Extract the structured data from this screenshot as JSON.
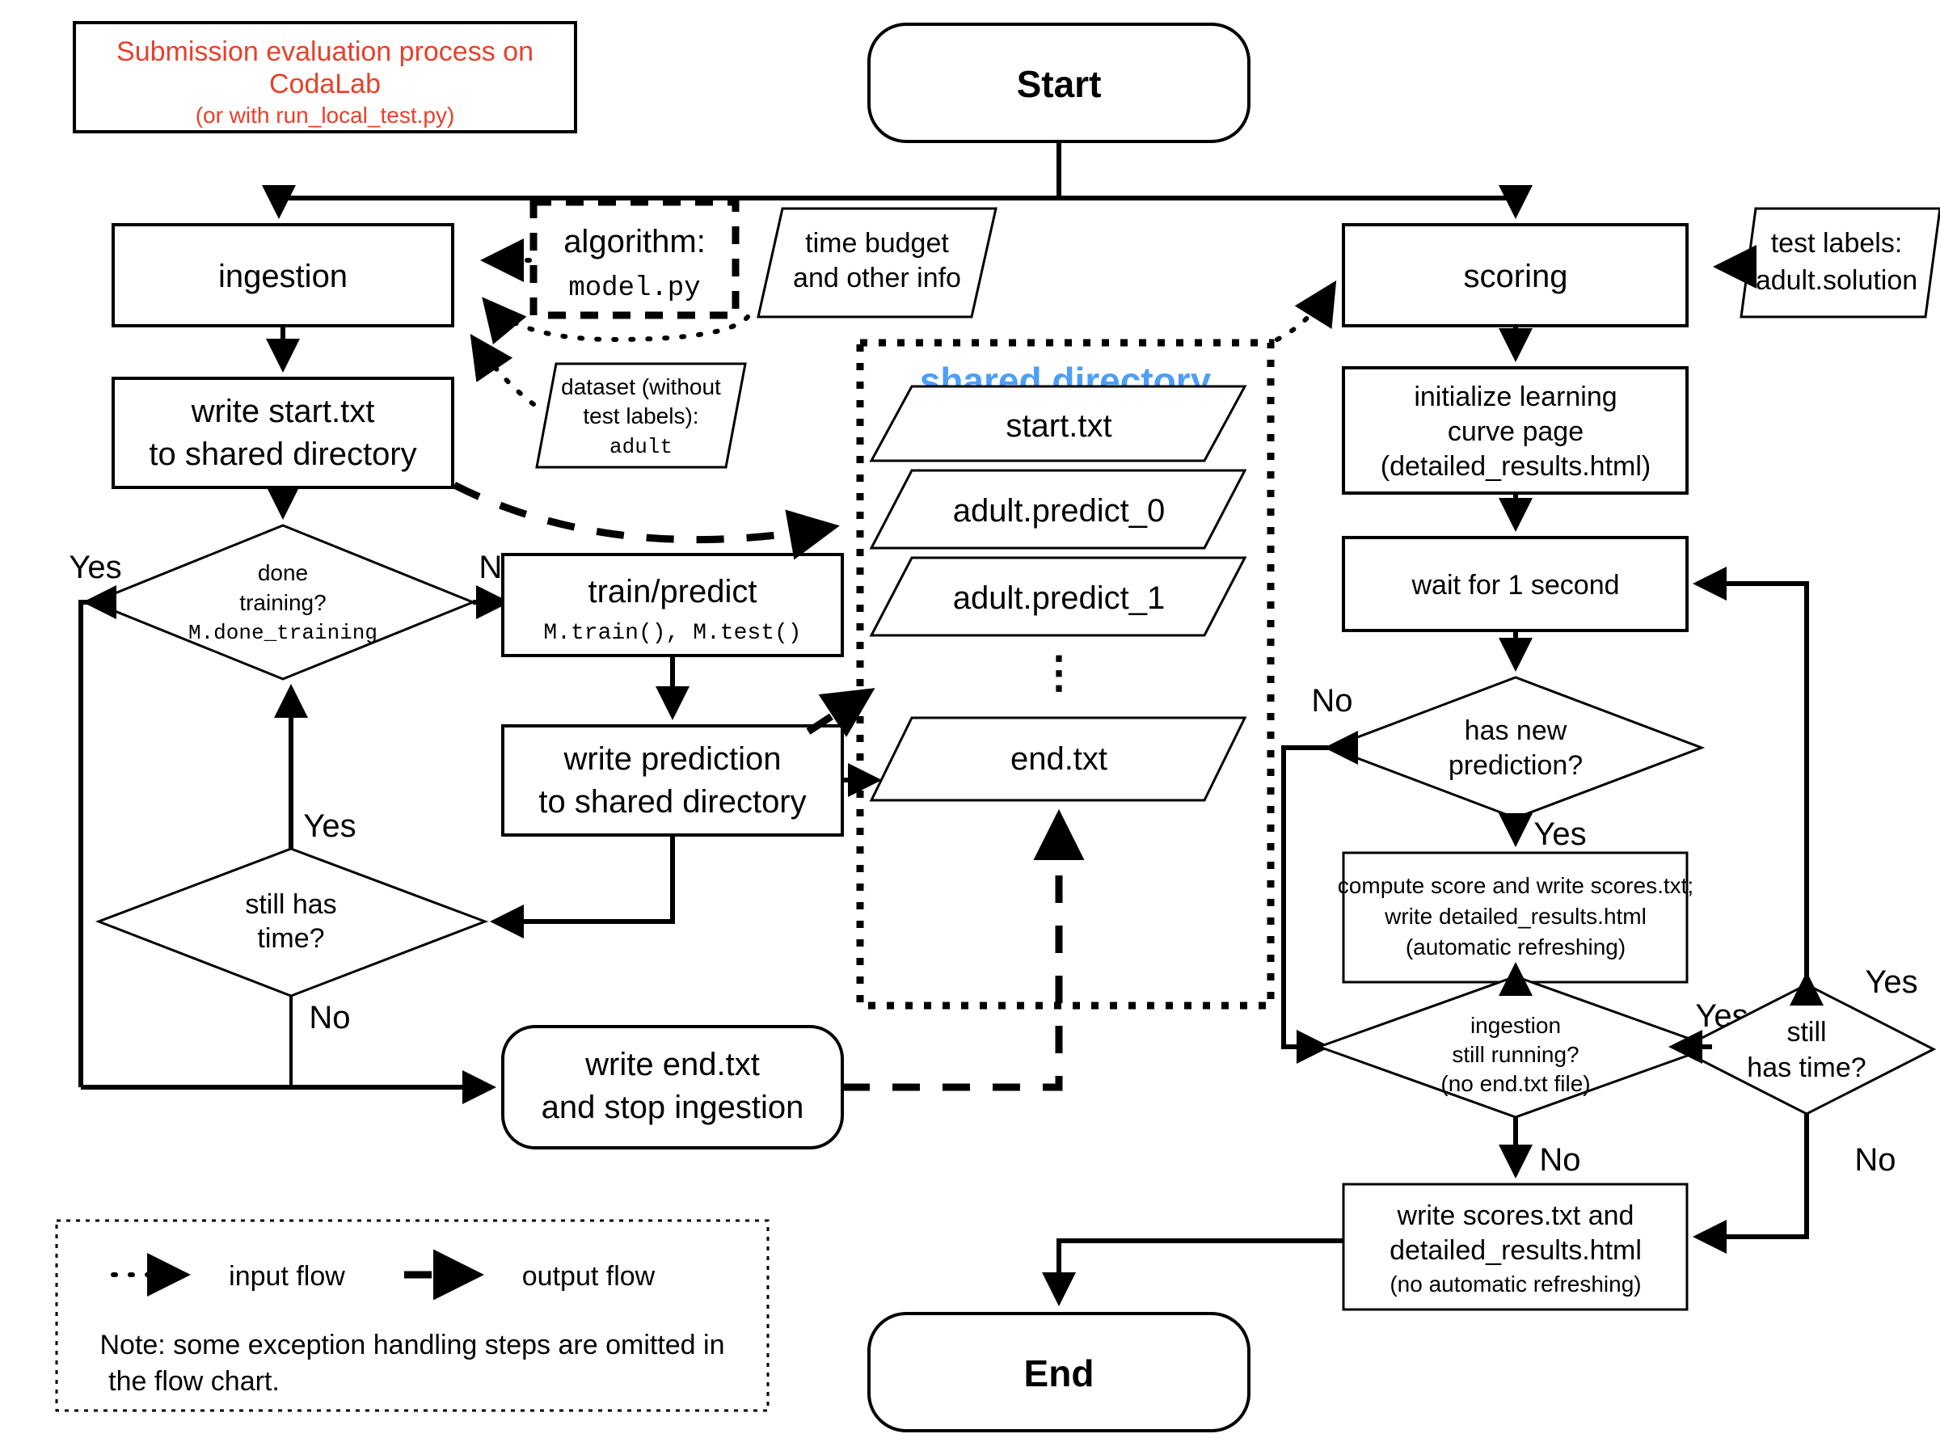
{
  "title_box": {
    "line1": "Submission evaluation process on",
    "line2": "CodaLab",
    "line3": "(or with run_local_test.py)",
    "color": "#e8402a"
  },
  "terminals": {
    "start": "Start",
    "end": "End"
  },
  "ingestion_branch": {
    "ingestion": "ingestion",
    "write_start_l1": "write start.txt",
    "write_start_l2": "to shared directory",
    "done_training_l1": "done",
    "done_training_l2": "training?",
    "done_training_code": "M.done_training",
    "train_predict": "train/predict",
    "train_predict_code": "M.train(), M.test()",
    "write_prediction_l1": "write prediction",
    "write_prediction_l2": "to shared directory",
    "still_has_time_l1": "still has",
    "still_has_time_l2": "time?",
    "write_end_l1": "write end.txt",
    "write_end_l2": "and stop ingestion"
  },
  "inputs": {
    "algorithm_label": "algorithm:",
    "algorithm_file": "model.py",
    "time_budget_l1": "time budget",
    "time_budget_l2": "and other info",
    "dataset_l1": "dataset (without",
    "dataset_l2": "test labels):",
    "dataset_name": "adult",
    "test_labels_l1": "test labels:",
    "test_labels_l2": "adult.solution"
  },
  "shared_directory": {
    "title": "shared directory",
    "title_color": "#4d9ef6",
    "files": [
      "start.txt",
      "adult.predict_0",
      "adult.predict_1",
      "end.txt"
    ],
    "ellipsis": "⋮"
  },
  "scoring_branch": {
    "scoring": "scoring",
    "init_l1": "initialize learning",
    "init_l2": "curve page",
    "init_l3": "(detailed_results.html)",
    "wait": "wait for 1 second",
    "has_new_pred_l1": "has new",
    "has_new_pred_l2": "prediction?",
    "compute_l1": "compute score and write scores.txt;",
    "compute_l2": "write detailed_results.html",
    "compute_l3": "(automatic refreshing)",
    "ingestion_running_l1": "ingestion",
    "ingestion_running_l2": "still running?",
    "ingestion_running_l3": "(no end.txt file)",
    "still_has_time_l1": "still",
    "still_has_time_l2": "has time?",
    "write_final_l1": "write scores.txt and",
    "write_final_l2": "detailed_results.html",
    "write_final_l3": "(no automatic refreshing)"
  },
  "edge_labels": {
    "done_training_yes": "Yes",
    "done_training_no": "No",
    "still_time_yes_left": "Yes",
    "still_time_no_left": "No",
    "has_new_pred_no": "No",
    "has_new_pred_yes": "Yes",
    "ingestion_running_yes": "Yes",
    "ingestion_running_no": "No",
    "scoring_time_yes": "Yes",
    "scoring_time_no": "No"
  },
  "legend": {
    "input_flow": "input flow",
    "output_flow": "output flow",
    "note_l1": "Note: some exception handling steps are omitted in",
    "note_l2": "the flow chart."
  }
}
